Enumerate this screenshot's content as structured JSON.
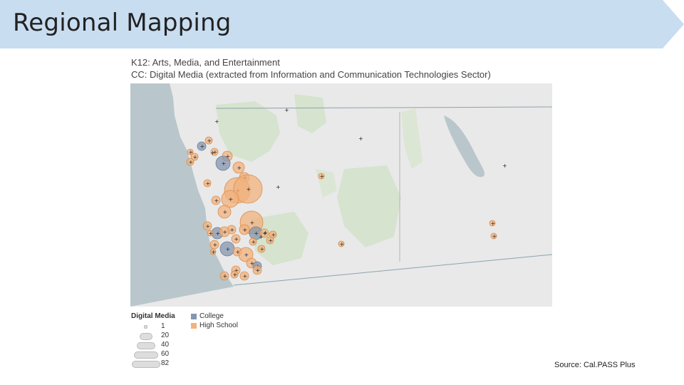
{
  "slide": {
    "title": "Regional Mapping",
    "source": "Source: Cal.PASS Plus",
    "colors": {
      "banner": "#c9ddf1",
      "college": "#8496b0",
      "high_school": "#f2b27c"
    }
  },
  "map": {
    "subtitle_line1": "K12: Arts, Media, and Entertainment",
    "subtitle_line2": "CC: Digital Media (extracted from Information and Communication Technologies Sector)",
    "legend": {
      "size_title": "Digital Media",
      "size_values": [
        "1",
        "20",
        "40",
        "60",
        "82"
      ],
      "categories": [
        {
          "label": "College",
          "color": "#8496b0"
        },
        {
          "label": "High School",
          "color": "#f2b27c"
        }
      ]
    }
  }
}
